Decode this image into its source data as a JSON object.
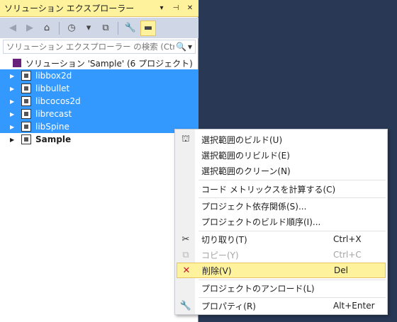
{
  "panel": {
    "title": "ソリューション エクスプローラー",
    "dropdown_icon": "▾",
    "pin_icon": "⊣",
    "close_icon": "✕"
  },
  "toolbar": {
    "back_icon": "◀",
    "forward_icon": "▶",
    "home_icon": "⌂",
    "history_icon": "◷",
    "history_dropdown_icon": "▾",
    "sync_icon": "⧉",
    "properties_icon": "🔧",
    "pin_view_icon": "▬"
  },
  "search": {
    "placeholder": "ソリューション エクスプローラー の検索 (Ctrl+;)",
    "icon": "🔍",
    "dropdown_icon": "▾"
  },
  "tree": {
    "solution_label": "ソリューション 'Sample' (6 プロジェクト)",
    "items": [
      {
        "label": "libbox2d"
      },
      {
        "label": "libbullet"
      },
      {
        "label": "libcocos2d"
      },
      {
        "label": "librecast"
      },
      {
        "label": "libSpine"
      },
      {
        "label": "Sample"
      }
    ],
    "expand_icon": "▶"
  },
  "context_menu": {
    "items": [
      {
        "label": "選択範囲のビルド(U)",
        "shortcut": "",
        "icon": "⛫"
      },
      {
        "label": "選択範囲のリビルド(E)",
        "shortcut": "",
        "icon": ""
      },
      {
        "label": "選択範囲のクリーン(N)",
        "shortcut": "",
        "icon": ""
      },
      {
        "label": "コード メトリックスを計算する(C)",
        "shortcut": "",
        "icon": ""
      },
      {
        "label": "プロジェクト依存関係(S)...",
        "shortcut": "",
        "icon": ""
      },
      {
        "label": "プロジェクトのビルド順序(I)...",
        "shortcut": "",
        "icon": ""
      },
      {
        "label": "切り取り(T)",
        "shortcut": "Ctrl+X",
        "icon": "✂"
      },
      {
        "label": "コピー(Y)",
        "shortcut": "Ctrl+C",
        "icon": "⧉"
      },
      {
        "label": "削除(V)",
        "shortcut": "Del",
        "icon": "✕"
      },
      {
        "label": "プロジェクトのアンロード(L)",
        "shortcut": "",
        "icon": ""
      },
      {
        "label": "プロパティ(R)",
        "shortcut": "Alt+Enter",
        "icon": "🔧"
      }
    ]
  },
  "colors": {
    "selection": "#3399ff",
    "title_highlight": "#fff29d",
    "background": "#293955",
    "delete_icon": "#c8102e"
  }
}
